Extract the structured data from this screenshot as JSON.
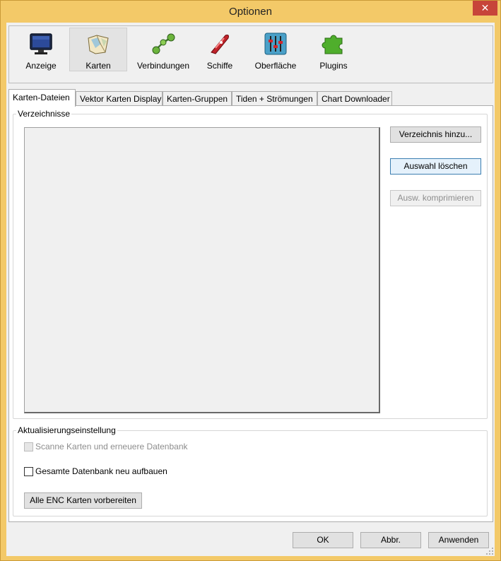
{
  "window": {
    "title": "Optionen",
    "close_glyph": "✕"
  },
  "toolbar": {
    "items": [
      {
        "label": "Anzeige",
        "icon": "monitor-icon"
      },
      {
        "label": "Karten",
        "icon": "chart-map-icon",
        "selected": true
      },
      {
        "label": "Verbindungen",
        "icon": "connections-icon"
      },
      {
        "label": "Schiffe",
        "icon": "ship-icon"
      },
      {
        "label": "Oberfläche",
        "icon": "sliders-icon"
      },
      {
        "label": "Plugins",
        "icon": "puzzle-icon"
      }
    ]
  },
  "tabs": [
    {
      "label": "Karten-Dateien",
      "active": true
    },
    {
      "label": "Vektor Karten Display"
    },
    {
      "label": "Karten-Gruppen"
    },
    {
      "label": "Tiden + Strömungen"
    },
    {
      "label": "Chart Downloader"
    }
  ],
  "directories": {
    "group_title": "Verzeichnisse",
    "entries": [],
    "add_button": "Verzeichnis hinzu...",
    "remove_button": "Auswahl löschen",
    "compress_button": "Ausw. komprimieren"
  },
  "update": {
    "group_title": "Aktualisierungseinstellung",
    "scan_label": "Scanne Karten und erneuere Datenbank",
    "scan_checked": false,
    "scan_enabled": false,
    "rebuild_label": "Gesamte Datenbank neu aufbauen",
    "rebuild_checked": false,
    "prepare_enc_button": "Alle ENC Karten vorbereiten"
  },
  "footer": {
    "ok_button": "OK",
    "cancel_button": "Abbr.",
    "apply_button": "Anwenden"
  },
  "colors": {
    "titlebar": "#f3c968",
    "close_button": "#c7453a",
    "focus_border": "#3c7fb1"
  }
}
